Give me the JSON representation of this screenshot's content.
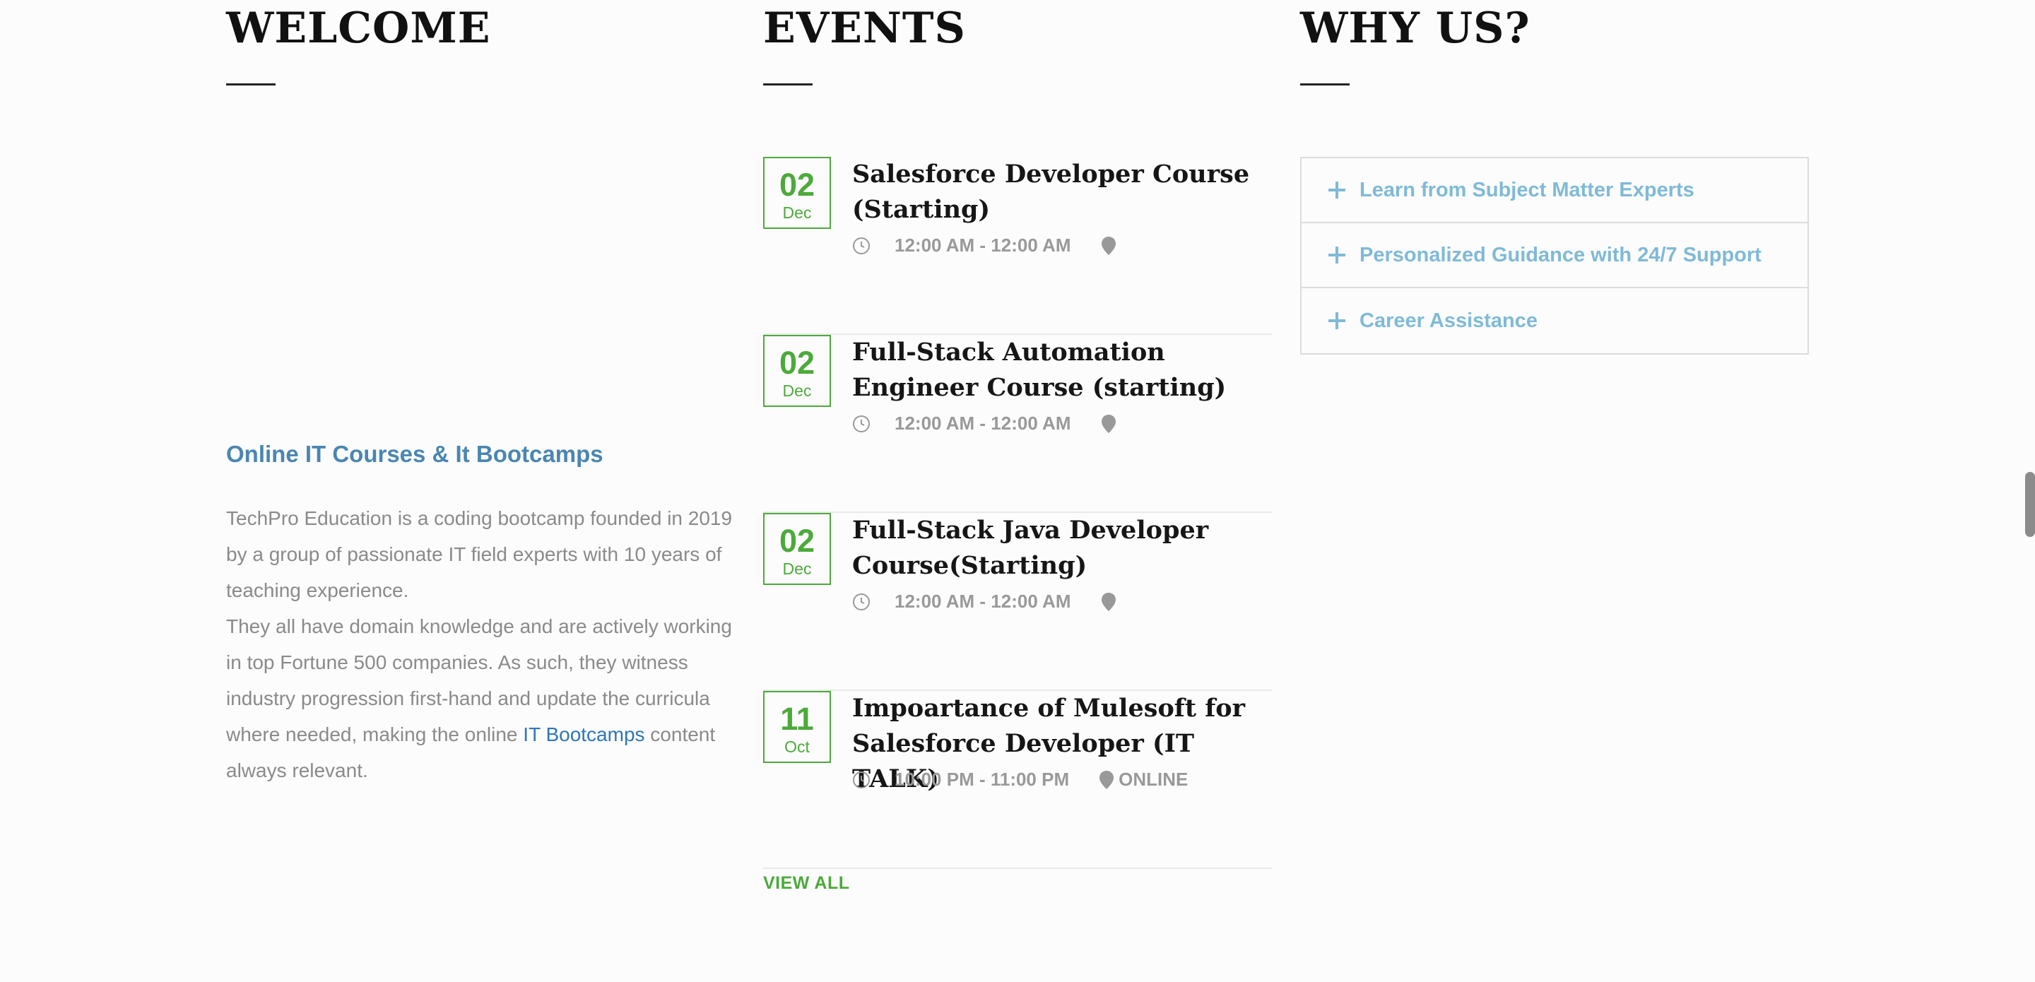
{
  "welcome": {
    "title": "WELCOME",
    "subtitle": "Online IT Courses & It Bootcamps",
    "paragraph1": "TechPro Education is a coding bootcamp founded in 2019 by a group of passionate IT field experts with 10 years of teaching experience.",
    "paragraph2_start": "They all have domain knowledge and are actively working in top Fortune 500 companies. As such, they witness industry progression first-hand and update the curricula where needed, making the online ",
    "paragraph2_link": "IT Bootcamps",
    "paragraph2_end": " content always relevant."
  },
  "events": {
    "title": "EVENTS",
    "items": [
      {
        "day": "02",
        "month": "Dec",
        "title": "Salesforce Developer Course (Starting)",
        "time": "12:00 AM - 12:00 AM",
        "location": ""
      },
      {
        "day": "02",
        "month": "Dec",
        "title": "Full-Stack Automation Engineer Course (starting)",
        "time": "12:00 AM - 12:00 AM",
        "location": ""
      },
      {
        "day": "02",
        "month": "Dec",
        "title": "Full-Stack Java Developer Course(Starting)",
        "time": "12:00 AM - 12:00 AM",
        "location": ""
      },
      {
        "day": "11",
        "month": "Oct",
        "title": "Impoartance of Mulesoft for Salesforce Developer (IT TALK)",
        "time": "10:00 PM - 11:00 PM",
        "location": "ONLINE"
      }
    ],
    "view_all": "VIEW ALL"
  },
  "why_us": {
    "title": "WHY US?",
    "items": [
      {
        "label": "Learn from Subject Matter Experts"
      },
      {
        "label": "Personalized Guidance with 24/7 Support"
      },
      {
        "label": "Career Assistance"
      }
    ]
  },
  "colors": {
    "accent_green": "#4caa3b",
    "link_blue": "#2f76b6",
    "accordion_blue": "#7fbad6"
  }
}
